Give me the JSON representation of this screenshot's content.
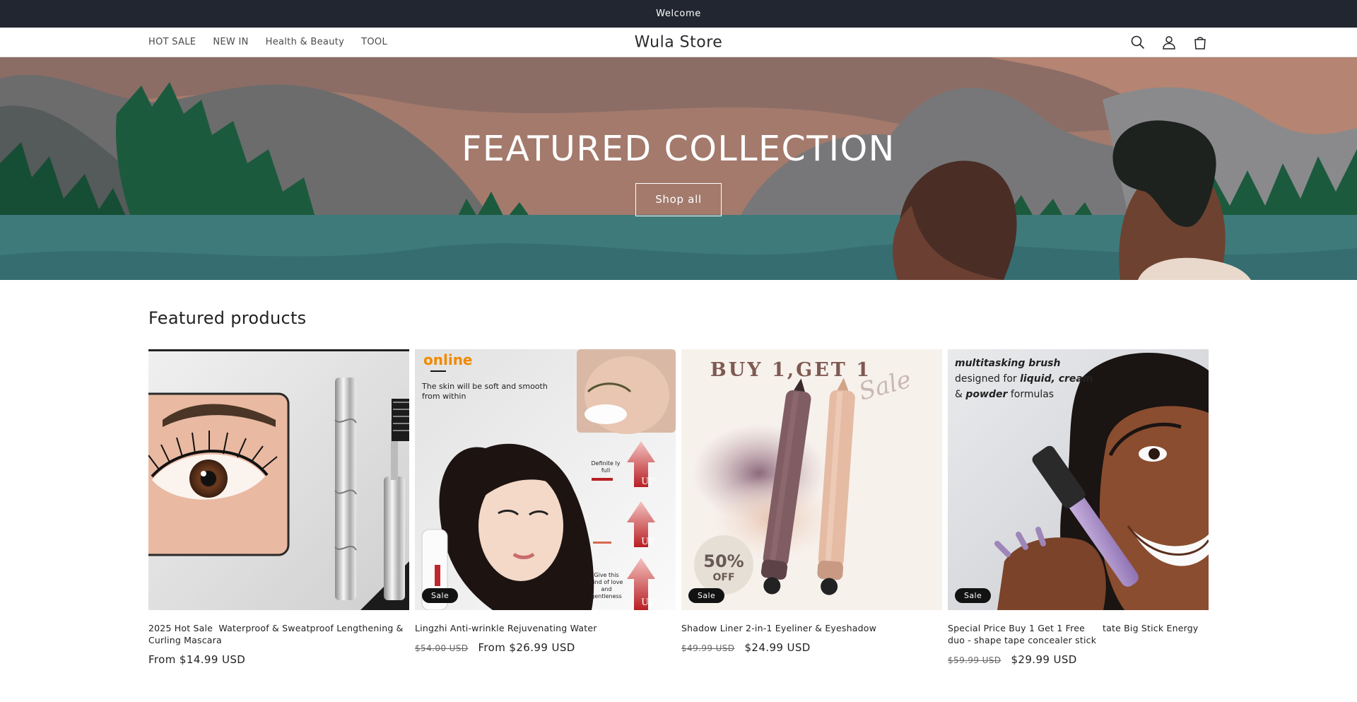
{
  "announcement": {
    "text": "Welcome"
  },
  "header": {
    "nav": [
      {
        "label": "HOT SALE"
      },
      {
        "label": "NEW IN"
      },
      {
        "label": "Health & Beauty"
      },
      {
        "label": "TOOL"
      }
    ],
    "logo": "Wula Store",
    "icons": [
      "search-icon",
      "account-icon",
      "cart-icon"
    ]
  },
  "hero": {
    "title": "FEATURED COLLECTION",
    "button": "Shop all"
  },
  "featured": {
    "title": "Featured products",
    "products": [
      {
        "title": "2025 Hot Sale  Waterproof & Sweatproof Lengthening & Curling Mascara",
        "old_price": "",
        "price": "From $14.99 USD",
        "badge": ""
      },
      {
        "title": "Lingzhi Anti-wrinkle Rejuvenating Water",
        "old_price": "$54.00 USD",
        "price": "From $26.99 USD",
        "badge": "Sale",
        "image_text": {
          "tag": "online",
          "caption": "The skin will be soft and smooth from within",
          "label1": "Definite ly full",
          "label2": "Give this kind of love and gentleness",
          "up": "UP"
        }
      },
      {
        "title": "Shadow Liner 2-in-1 Eyeliner & Eyeshadow",
        "old_price": "$49.99 USD",
        "price": "$24.99 USD",
        "badge": "Sale",
        "image_text": {
          "headline": "BUY 1,GET 1",
          "script": "Sale",
          "off_top": "50%",
          "off_bottom": "OFF"
        }
      },
      {
        "title": "Special Price Buy 1 Get 1 Free      tate Big Stick Energy duo - shape tape concealer stick",
        "old_price": "$59.99 USD",
        "price": "$29.99 USD",
        "badge": "Sale",
        "image_text": {
          "line1": "multitasking brush",
          "line2_a": "designed for ",
          "line2_b": "liquid, cream",
          "line3_a": "& ",
          "line3_b": "powder",
          "line3_c": " formulas"
        }
      }
    ]
  },
  "colors": {
    "announcement_bg": "#222630",
    "hero_teal": "#3f7a7a",
    "badge_bg": "#121212"
  }
}
